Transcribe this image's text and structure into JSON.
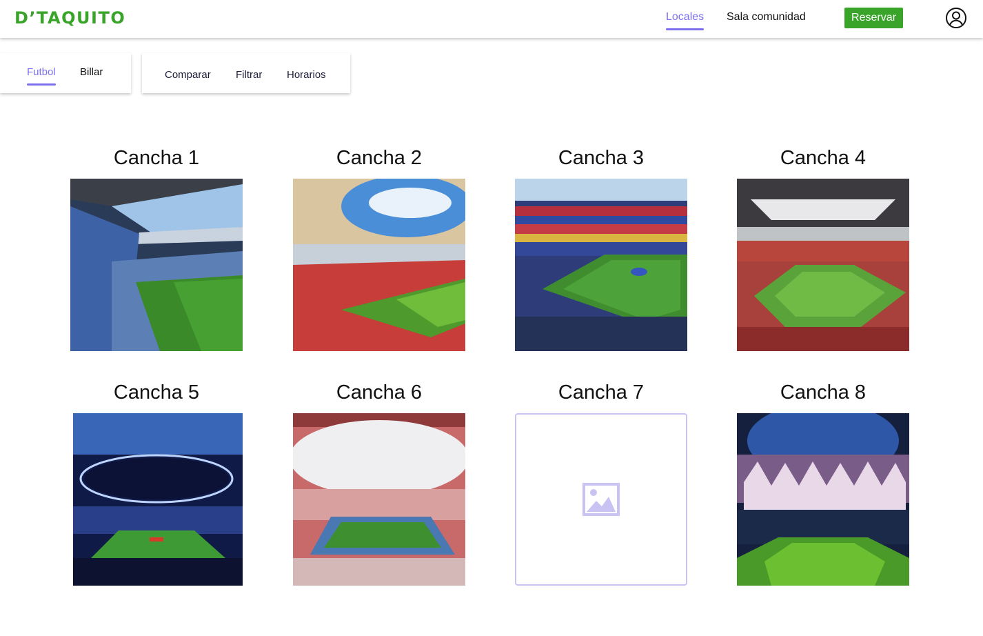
{
  "header": {
    "logo": "D’TAQUITO",
    "nav": [
      {
        "label": "Locales",
        "active": true
      },
      {
        "label": "Sala comunidad",
        "active": false
      }
    ],
    "reserve_label": "Reservar",
    "profile_icon": "user-circle-icon"
  },
  "sport_tabs": [
    {
      "label": "Futbol",
      "active": true
    },
    {
      "label": "Billar",
      "active": false
    }
  ],
  "toolbar": {
    "compare_label": "Comparar",
    "filter_label": "Filtrar",
    "schedule_label": "Horarios"
  },
  "courts": [
    {
      "name": "Cancha 1",
      "image": "stadium-photo-blue-seats"
    },
    {
      "name": "Cancha 2",
      "image": "stadium-photo-red-seats-open-sky"
    },
    {
      "name": "Cancha 3",
      "image": "stadium-photo-colorful-crowd"
    },
    {
      "name": "Cancha 4",
      "image": "stadium-photo-red-seats-roof"
    },
    {
      "name": "Cancha 5",
      "image": "stadium-render-night-lights"
    },
    {
      "name": "Cancha 6",
      "image": "stadium-photo-athletics-track"
    },
    {
      "name": "Cancha 7",
      "image": "image-placeholder-icon"
    },
    {
      "name": "Cancha 8",
      "image": "stadium-photo-night-fireworks"
    }
  ],
  "colors": {
    "brand_green": "#3aa42a",
    "accent_purple": "#7b6ff0",
    "placeholder_border": "#c9c3f3"
  }
}
